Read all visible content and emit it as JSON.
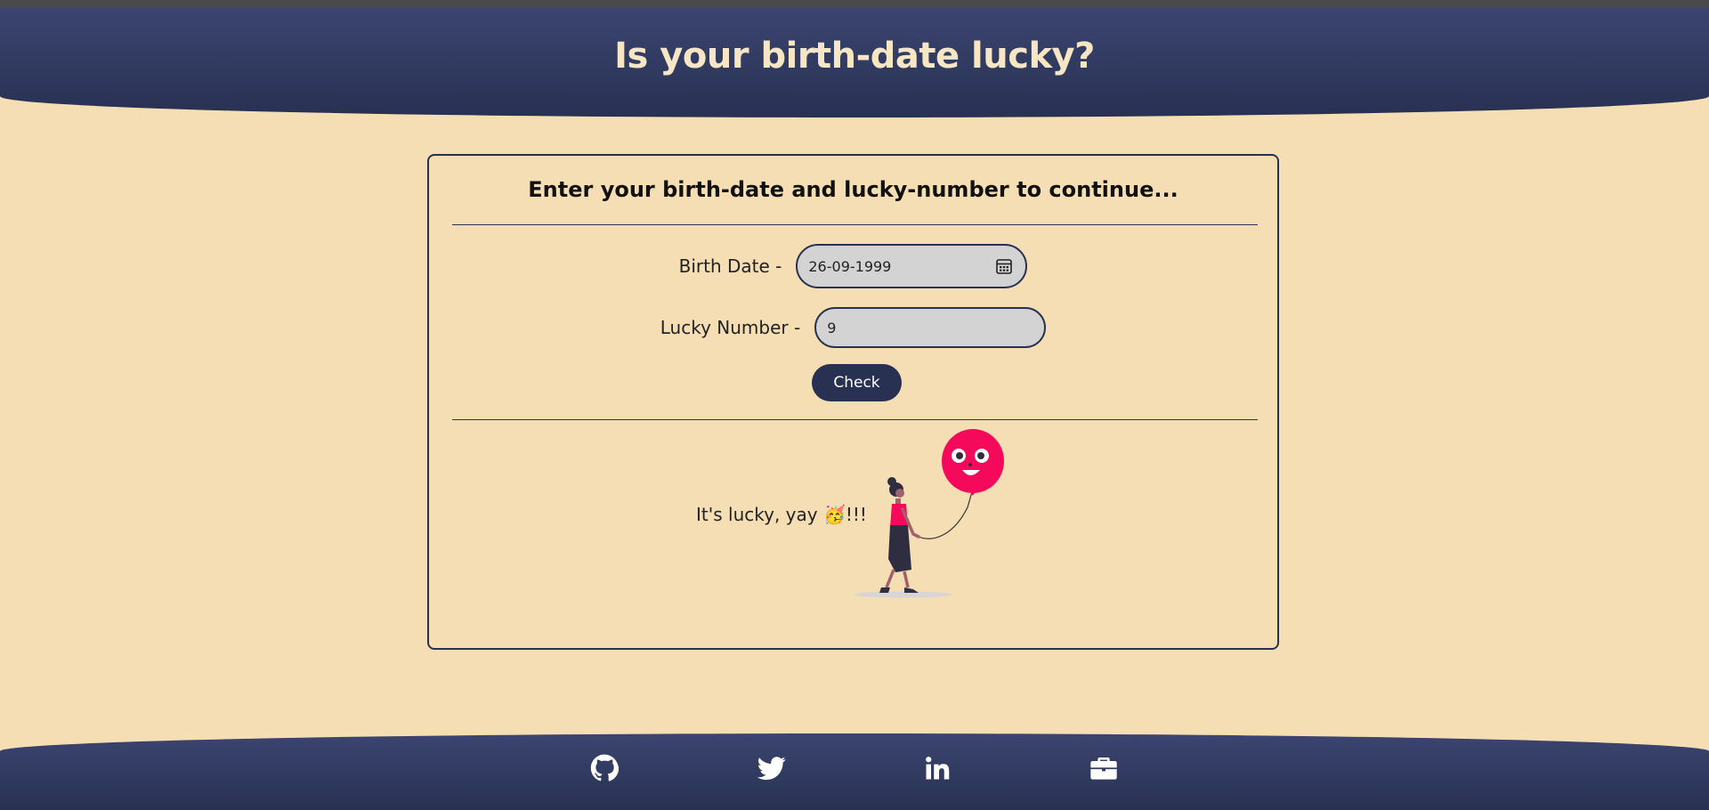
{
  "header": {
    "title": "Is your birth-date lucky?"
  },
  "card": {
    "title": "Enter your birth-date and lucky-number to continue...",
    "birth_date_label": "Birth Date -",
    "birth_date_value": "26-09-1999",
    "lucky_number_label": "Lucky Number -",
    "lucky_number_value": "9",
    "check_label": "Check",
    "result_text": "It's lucky, yay 🥳!!!"
  },
  "footer": {
    "icons": [
      "github-icon",
      "twitter-icon",
      "linkedin-icon",
      "briefcase-icon"
    ]
  },
  "colors": {
    "background": "#f5deb3",
    "primary": "#283152",
    "balloon": "#f5095a"
  }
}
